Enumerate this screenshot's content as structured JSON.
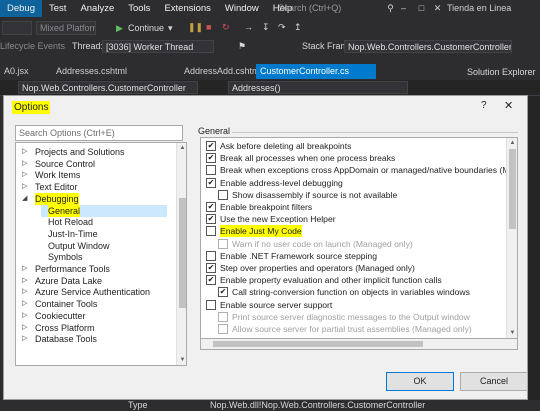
{
  "menu": {
    "items": [
      "Debug",
      "Test",
      "Analyze",
      "Tools",
      "Extensions",
      "Window",
      "Help"
    ],
    "quick_launch_placeholder": "Search (Ctrl+Q)",
    "project_name": "Tienda en Linea"
  },
  "toolbar": {
    "platform": "Mixed Platforms",
    "continue_label": "Continue",
    "thread_label": "Thread:",
    "thread_value": "[3036] Worker Thread",
    "stack_frame_label": "Stack Frame:",
    "stack_frame_value": "Nop.Web.Controllers.CustomerController",
    "lifecycle_label": "Lifecycle Events"
  },
  "doc_tabs": [
    {
      "label": "A0.jsx"
    },
    {
      "label": "Addresses.cshtml"
    },
    {
      "label": "AddressAdd.cshtml"
    },
    {
      "label": "CustomerController.cs"
    }
  ],
  "solution_explorer_title": "Solution Explorer",
  "nav_bar": {
    "class_combo": "Nop.Web.Controllers.CustomerController",
    "member_combo": "Addresses()"
  },
  "dialog": {
    "title": "Options",
    "help": "?",
    "close": "✕",
    "search_placeholder": "Search Options (Ctrl+E)",
    "tree": [
      {
        "label": "Projects and Solutions",
        "expanded": false
      },
      {
        "label": "Source Control",
        "expanded": false
      },
      {
        "label": "Work Items",
        "expanded": false
      },
      {
        "label": "Text Editor",
        "expanded": false
      },
      {
        "label": "Debugging",
        "expanded": true
      },
      {
        "label": "General",
        "child": true,
        "selected": true
      },
      {
        "label": "Hot Reload",
        "child": true
      },
      {
        "label": "Just-In-Time",
        "child": true
      },
      {
        "label": "Output Window",
        "child": true
      },
      {
        "label": "Symbols",
        "child": true
      },
      {
        "label": "Performance Tools",
        "expanded": false
      },
      {
        "label": "Azure Data Lake",
        "expanded": false
      },
      {
        "label": "Azure Service Authentication",
        "expanded": false
      },
      {
        "label": "Container Tools",
        "expanded": false
      },
      {
        "label": "Cookiecutter",
        "expanded": false
      },
      {
        "label": "Cross Platform",
        "expanded": false
      },
      {
        "label": "Database Tools",
        "expanded": false
      }
    ],
    "section_title": "General",
    "options": [
      {
        "label": "Ask before deleting all breakpoints",
        "checked": true
      },
      {
        "label": "Break all processes when one process breaks",
        "checked": true
      },
      {
        "label": "Break when exceptions cross AppDomain or managed/native boundaries (Ma",
        "checked": false
      },
      {
        "label": "Enable address-level debugging",
        "checked": true
      },
      {
        "label": "Show disassembly if source is not available",
        "checked": false,
        "indent": true
      },
      {
        "label": "Enable breakpoint filters",
        "checked": true
      },
      {
        "label": "Use the new Exception Helper",
        "checked": true
      },
      {
        "label": "Enable Just My Code",
        "checked": false,
        "highlight": true
      },
      {
        "label": "Warn if no user code on launch (Managed only)",
        "checked": false,
        "indent": true,
        "disabled": true
      },
      {
        "label": "Enable .NET Framework source stepping",
        "checked": false
      },
      {
        "label": "Step over properties and operators (Managed only)",
        "checked": true
      },
      {
        "label": "Enable property evaluation and other implicit function calls",
        "checked": true
      },
      {
        "label": "Call string-conversion function on objects in variables windows",
        "checked": true,
        "indent": true
      },
      {
        "label": "Enable source server support",
        "checked": false
      },
      {
        "label": "Print source server diagnostic messages to the Output window",
        "checked": false,
        "indent": true,
        "disabled": true
      },
      {
        "label": "Allow source server for partial trust assemblies (Managed only)",
        "checked": false,
        "indent": true,
        "disabled": true
      }
    ],
    "ok_label": "OK",
    "cancel_label": "Cancel"
  },
  "status": {
    "type_label": "Type",
    "bottom_path": "Nop.Web.dll!Nop.Web.Controllers.CustomerController"
  },
  "colors": {
    "vs_background": "#2d2d30",
    "accent": "#007acc",
    "highlight": "#ffff00",
    "dialog_bg": "#f0f0f0"
  }
}
